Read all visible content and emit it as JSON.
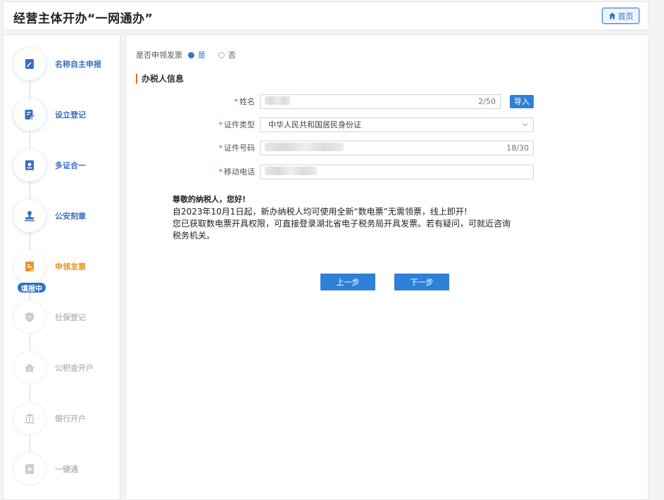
{
  "header": {
    "title": "经营主体开办“一网通办”",
    "home_label": "首页"
  },
  "sidebar": {
    "steps": [
      {
        "label": "名称自主申报",
        "state": "done",
        "icon": "name-declare-icon"
      },
      {
        "label": "设立登记",
        "state": "done",
        "icon": "registration-edit-icon"
      },
      {
        "label": "多证合一",
        "state": "done",
        "icon": "license-merge-icon"
      },
      {
        "label": "公安刻章",
        "state": "done",
        "icon": "seal-stamp-icon"
      },
      {
        "label": "申领发票",
        "state": "current",
        "icon": "invoice-icon"
      },
      {
        "label": "社保登记",
        "state": "inactive",
        "icon": "social-security-shield-icon"
      },
      {
        "label": "公积金开户",
        "state": "inactive",
        "icon": "housing-fund-icon"
      },
      {
        "label": "银行开户",
        "state": "inactive",
        "icon": "bank-icon"
      },
      {
        "label": "一键通",
        "state": "inactive",
        "icon": "one-click-icon"
      }
    ],
    "current_badge": "填报中"
  },
  "main": {
    "invoice_question": "是否申领发票",
    "invoice_options": {
      "yes": "是",
      "no": "否",
      "selected": "yes"
    },
    "section_title": "办税人信息",
    "form": {
      "name": {
        "label": "姓名",
        "counter": "2/50",
        "import_label": "导入"
      },
      "id_type": {
        "label": "证件类型",
        "value": "中华人民共和国居民身份证"
      },
      "id_number": {
        "label": "证件号码",
        "counter": "18/30"
      },
      "mobile": {
        "label": "移动电话"
      },
      "required_mark": "*"
    },
    "notice": {
      "greeting": "尊敬的纳税人，您好!",
      "line1": "自2023年10月1日起，新办纳税人均可使用全新“数电票”无需领票，线上即开!",
      "line2": "您已获取数电票开具权限，可直接登录湖北省电子税务局开具发票。若有疑问，可就近咨询",
      "line3": "税务机关。"
    },
    "buttons": {
      "prev": "上一步",
      "next": "下一步"
    }
  },
  "colors": {
    "primary": "#2f80d8",
    "current_step": "#e0952a",
    "required": "#e0403a",
    "accent_bar": "#e8672c"
  }
}
